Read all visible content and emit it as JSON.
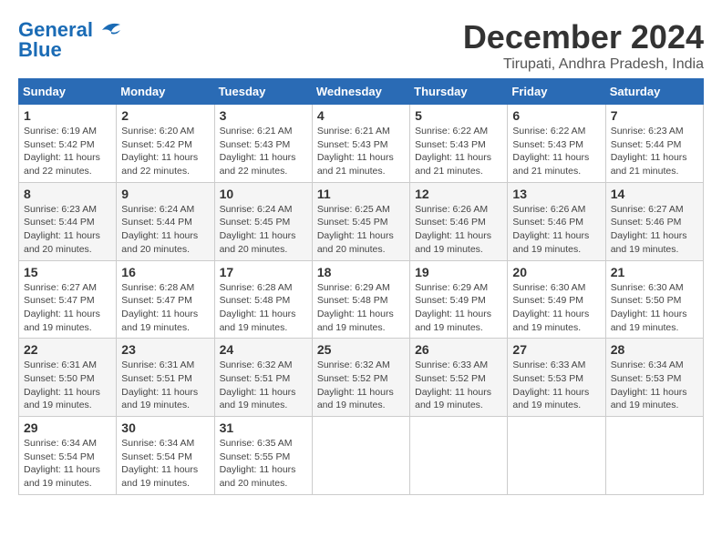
{
  "logo": {
    "line1": "General",
    "line2": "Blue"
  },
  "title": "December 2024",
  "location": "Tirupati, Andhra Pradesh, India",
  "weekdays": [
    "Sunday",
    "Monday",
    "Tuesday",
    "Wednesday",
    "Thursday",
    "Friday",
    "Saturday"
  ],
  "weeks": [
    [
      {
        "day": "1",
        "info": "Sunrise: 6:19 AM\nSunset: 5:42 PM\nDaylight: 11 hours\nand 22 minutes."
      },
      {
        "day": "2",
        "info": "Sunrise: 6:20 AM\nSunset: 5:42 PM\nDaylight: 11 hours\nand 22 minutes."
      },
      {
        "day": "3",
        "info": "Sunrise: 6:21 AM\nSunset: 5:43 PM\nDaylight: 11 hours\nand 22 minutes."
      },
      {
        "day": "4",
        "info": "Sunrise: 6:21 AM\nSunset: 5:43 PM\nDaylight: 11 hours\nand 21 minutes."
      },
      {
        "day": "5",
        "info": "Sunrise: 6:22 AM\nSunset: 5:43 PM\nDaylight: 11 hours\nand 21 minutes."
      },
      {
        "day": "6",
        "info": "Sunrise: 6:22 AM\nSunset: 5:43 PM\nDaylight: 11 hours\nand 21 minutes."
      },
      {
        "day": "7",
        "info": "Sunrise: 6:23 AM\nSunset: 5:44 PM\nDaylight: 11 hours\nand 21 minutes."
      }
    ],
    [
      {
        "day": "8",
        "info": "Sunrise: 6:23 AM\nSunset: 5:44 PM\nDaylight: 11 hours\nand 20 minutes."
      },
      {
        "day": "9",
        "info": "Sunrise: 6:24 AM\nSunset: 5:44 PM\nDaylight: 11 hours\nand 20 minutes."
      },
      {
        "day": "10",
        "info": "Sunrise: 6:24 AM\nSunset: 5:45 PM\nDaylight: 11 hours\nand 20 minutes."
      },
      {
        "day": "11",
        "info": "Sunrise: 6:25 AM\nSunset: 5:45 PM\nDaylight: 11 hours\nand 20 minutes."
      },
      {
        "day": "12",
        "info": "Sunrise: 6:26 AM\nSunset: 5:46 PM\nDaylight: 11 hours\nand 19 minutes."
      },
      {
        "day": "13",
        "info": "Sunrise: 6:26 AM\nSunset: 5:46 PM\nDaylight: 11 hours\nand 19 minutes."
      },
      {
        "day": "14",
        "info": "Sunrise: 6:27 AM\nSunset: 5:46 PM\nDaylight: 11 hours\nand 19 minutes."
      }
    ],
    [
      {
        "day": "15",
        "info": "Sunrise: 6:27 AM\nSunset: 5:47 PM\nDaylight: 11 hours\nand 19 minutes."
      },
      {
        "day": "16",
        "info": "Sunrise: 6:28 AM\nSunset: 5:47 PM\nDaylight: 11 hours\nand 19 minutes."
      },
      {
        "day": "17",
        "info": "Sunrise: 6:28 AM\nSunset: 5:48 PM\nDaylight: 11 hours\nand 19 minutes."
      },
      {
        "day": "18",
        "info": "Sunrise: 6:29 AM\nSunset: 5:48 PM\nDaylight: 11 hours\nand 19 minutes."
      },
      {
        "day": "19",
        "info": "Sunrise: 6:29 AM\nSunset: 5:49 PM\nDaylight: 11 hours\nand 19 minutes."
      },
      {
        "day": "20",
        "info": "Sunrise: 6:30 AM\nSunset: 5:49 PM\nDaylight: 11 hours\nand 19 minutes."
      },
      {
        "day": "21",
        "info": "Sunrise: 6:30 AM\nSunset: 5:50 PM\nDaylight: 11 hours\nand 19 minutes."
      }
    ],
    [
      {
        "day": "22",
        "info": "Sunrise: 6:31 AM\nSunset: 5:50 PM\nDaylight: 11 hours\nand 19 minutes."
      },
      {
        "day": "23",
        "info": "Sunrise: 6:31 AM\nSunset: 5:51 PM\nDaylight: 11 hours\nand 19 minutes."
      },
      {
        "day": "24",
        "info": "Sunrise: 6:32 AM\nSunset: 5:51 PM\nDaylight: 11 hours\nand 19 minutes."
      },
      {
        "day": "25",
        "info": "Sunrise: 6:32 AM\nSunset: 5:52 PM\nDaylight: 11 hours\nand 19 minutes."
      },
      {
        "day": "26",
        "info": "Sunrise: 6:33 AM\nSunset: 5:52 PM\nDaylight: 11 hours\nand 19 minutes."
      },
      {
        "day": "27",
        "info": "Sunrise: 6:33 AM\nSunset: 5:53 PM\nDaylight: 11 hours\nand 19 minutes."
      },
      {
        "day": "28",
        "info": "Sunrise: 6:34 AM\nSunset: 5:53 PM\nDaylight: 11 hours\nand 19 minutes."
      }
    ],
    [
      {
        "day": "29",
        "info": "Sunrise: 6:34 AM\nSunset: 5:54 PM\nDaylight: 11 hours\nand 19 minutes."
      },
      {
        "day": "30",
        "info": "Sunrise: 6:34 AM\nSunset: 5:54 PM\nDaylight: 11 hours\nand 19 minutes."
      },
      {
        "day": "31",
        "info": "Sunrise: 6:35 AM\nSunset: 5:55 PM\nDaylight: 11 hours\nand 20 minutes."
      },
      {
        "day": "",
        "info": ""
      },
      {
        "day": "",
        "info": ""
      },
      {
        "day": "",
        "info": ""
      },
      {
        "day": "",
        "info": ""
      }
    ]
  ]
}
